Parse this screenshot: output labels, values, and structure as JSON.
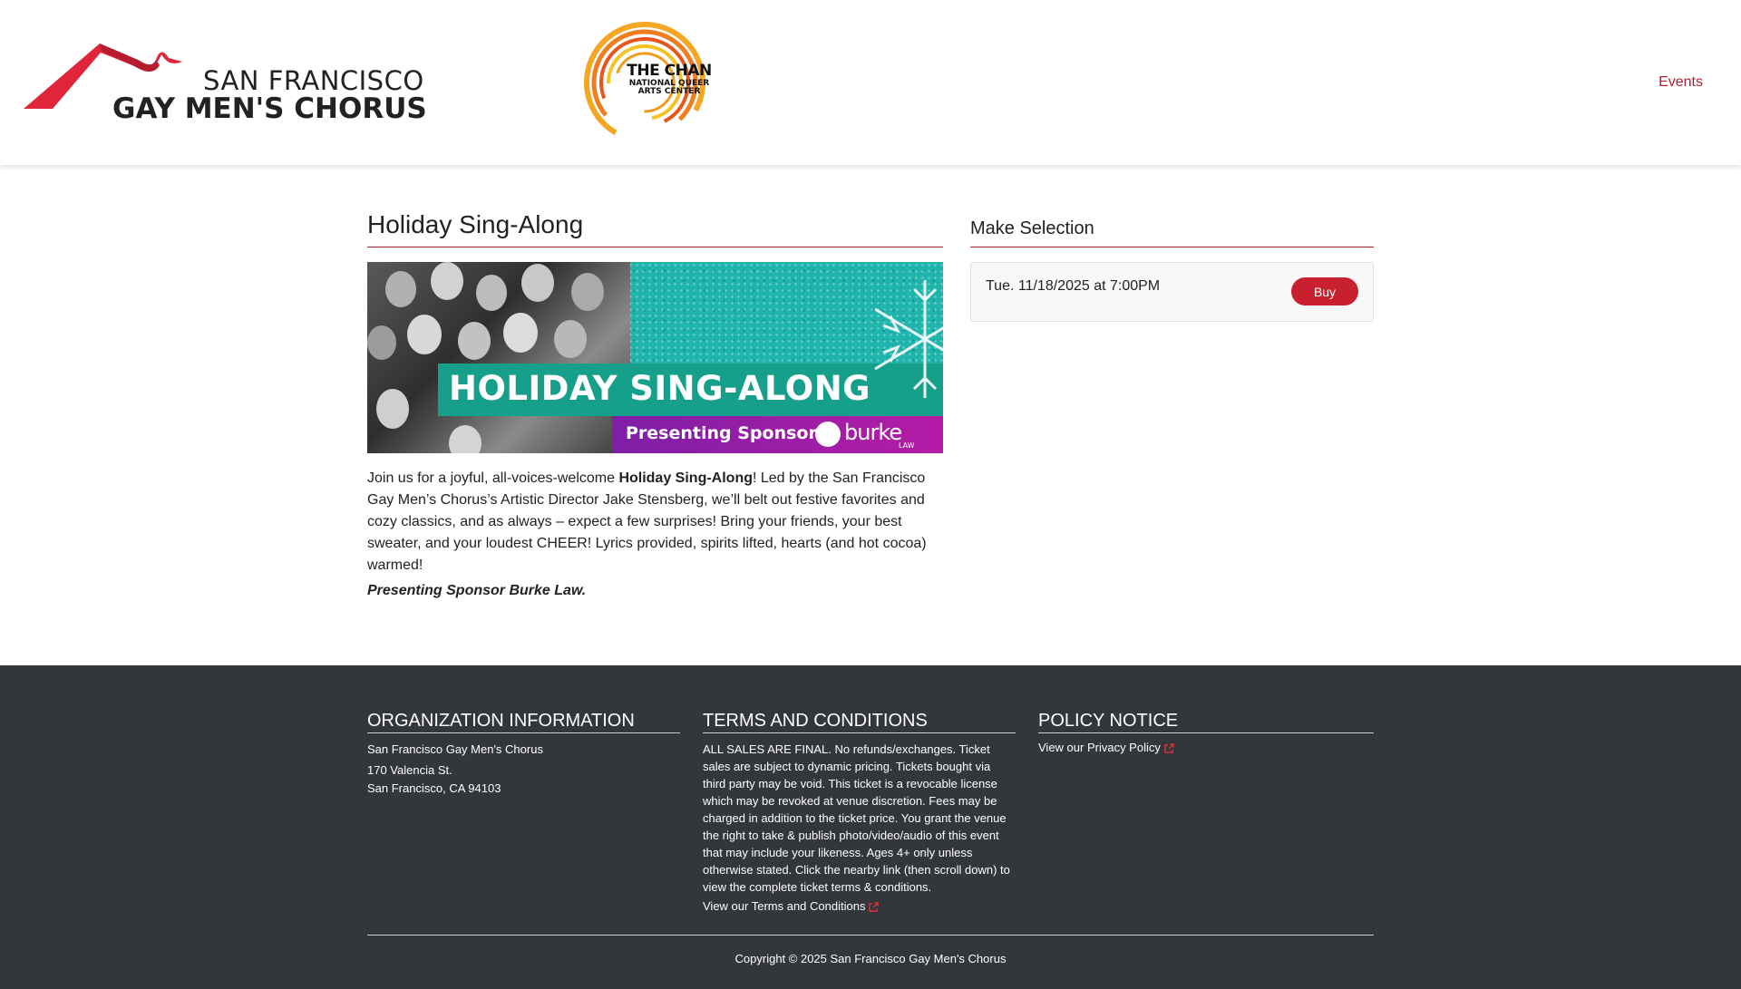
{
  "header": {
    "sfgmc_logo_line1": "SAN FRANCISCO",
    "sfgmc_logo_line2": "GAY MEN'S CHORUS",
    "chan_logo_line1": "THE CHAN",
    "chan_logo_line2": "NATIONAL QUEER",
    "chan_logo_line3": "ARTS CENTER",
    "nav_events": "Events"
  },
  "event": {
    "title": "Holiday Sing-Along",
    "banner": {
      "headline": "HOLIDAY SING-ALONG",
      "sponsor_label": "Presenting Sponsor",
      "sponsor_logo_word": "burke",
      "sponsor_logo_sub": "LAW"
    },
    "description_pre": "Join us for a joyful, all-voices-welcome ",
    "description_bold": "Holiday Sing-Along",
    "description_post": "! Led by the San Francisco Gay Men’s Chorus’s Artistic Director Jake Stensberg, we’ll belt out festive favorites and cozy classics, and as always – expect a few surprises! Bring your friends, your best sweater, and your loudest CHEER! Lyrics provided, spirits lifted, hearts (and hot cocoa) warmed!",
    "sponsor_line": "Presenting Sponsor Burke Law."
  },
  "selection": {
    "title": "Make Selection",
    "performances": [
      {
        "date": "Tue. 11/18/2025 at 7:00PM",
        "button": "Buy"
      }
    ]
  },
  "footer": {
    "org": {
      "heading": "ORGANIZATION INFORMATION",
      "name": "San Francisco Gay Men's Chorus",
      "address1": "170 Valencia St.",
      "address2": "San Francisco, CA 94103"
    },
    "terms": {
      "heading": "TERMS AND CONDITIONS",
      "text": "ALL SALES ARE FINAL. No refunds/exchanges. Ticket sales are subject to dynamic pricing. Tickets bought via third party may be void. This ticket is a revocable license which may be revoked at venue discretion. Fees may be charged in addition to the ticket price. You grant the venue the right to take & publish photo/video/audio of this event that may include your likeness. Ages 4+ only unless otherwise stated. Click the nearby link (then scroll down) to view the complete ticket terms & conditions.",
      "link": "View our Terms and Conditions"
    },
    "policy": {
      "heading": "POLICY NOTICE",
      "link": "View our Privacy Policy"
    },
    "copyright": "Copyright © 2025 San Francisco Gay Men's Chorus"
  },
  "colors": {
    "accent": "#b11e2f",
    "buy_button": "#c8202e",
    "footer_bg": "#33363b",
    "external_link_icon": "#e0303a"
  }
}
